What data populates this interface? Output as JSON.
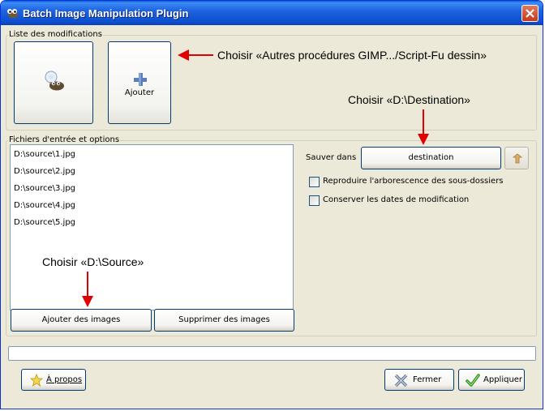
{
  "window": {
    "title": "Batch Image Manipulation Plugin"
  },
  "modifications": {
    "group_label": "Liste des modifications",
    "add_label": "Ajouter"
  },
  "annotations": {
    "gimp_procedures": "Choisir «Autres procédures GIMP.../Script-Fu dessin»",
    "destination": "Choisir «D:\\Destination»",
    "source": "Choisir «D:\\Source»"
  },
  "input": {
    "group_label": "Fichiers d'entrée et options",
    "files": [
      "D:\\source\\1.jpg",
      "D:\\source\\2.jpg",
      "D:\\source\\3.jpg",
      "D:\\source\\4.jpg",
      "D:\\source\\5.jpg"
    ],
    "add_images_label": "Ajouter des images",
    "remove_images_label": "Supprimer des images"
  },
  "output": {
    "save_in_label": "Sauver dans",
    "destination_value": "destination",
    "keep_folder_tree_label": "Reproduire l'arborescence des sous-dossiers",
    "keep_folder_tree_checked": false,
    "keep_dates_label": "Conserver les dates de modification",
    "keep_dates_checked": false
  },
  "progress": {
    "value": 0
  },
  "footer": {
    "about_label": "À propos",
    "close_label": "Fermer",
    "apply_label": "Appliquer"
  },
  "icons": {
    "app": "gimp-wilber-icon",
    "gimp_procedure": "gimp-procedure-icon",
    "add": "plus-icon",
    "folder_up": "folder-up-arrow-icon",
    "about": "star-icon",
    "close": "x-icon",
    "apply": "checkmark-icon",
    "arrow": "red-arrow-icon"
  },
  "colors": {
    "titlebar": "#0c4fcf",
    "window_bg": "#ece9d8",
    "annotation_arrow": "#e00000",
    "add_icon": "#5a7fb8"
  }
}
